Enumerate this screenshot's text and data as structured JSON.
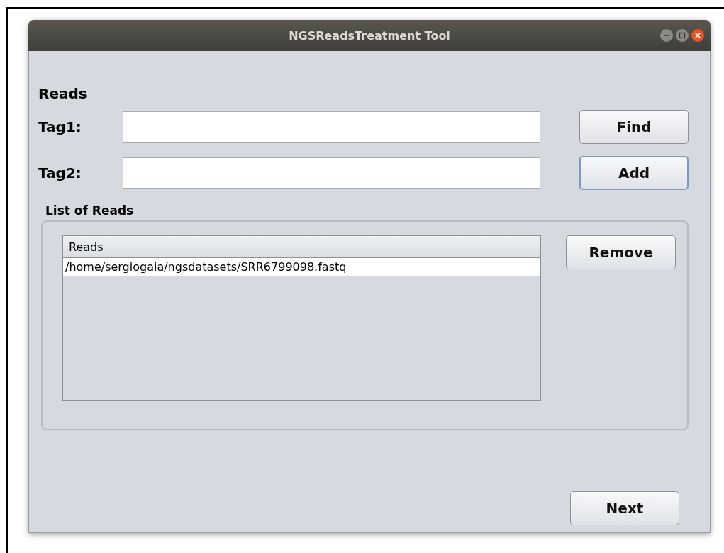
{
  "window": {
    "title": "NGSReadsTreatment Tool"
  },
  "heading": "Reads",
  "tags": [
    {
      "label": "Tag1:",
      "button": {
        "label": "Find",
        "focused": false
      }
    },
    {
      "label": "Tag2:",
      "button": {
        "label": "Add",
        "focused": true
      }
    }
  ],
  "list_panel": {
    "title": "List of Reads",
    "table": {
      "columns": [
        "Reads"
      ],
      "rows": [
        [
          "/home/sergiogaia/ngsdatasets/SRR6799098.fastq"
        ]
      ]
    },
    "button": {
      "label": "Remove",
      "focused": false
    }
  },
  "next_button": {
    "label": "Next",
    "focused": false
  }
}
